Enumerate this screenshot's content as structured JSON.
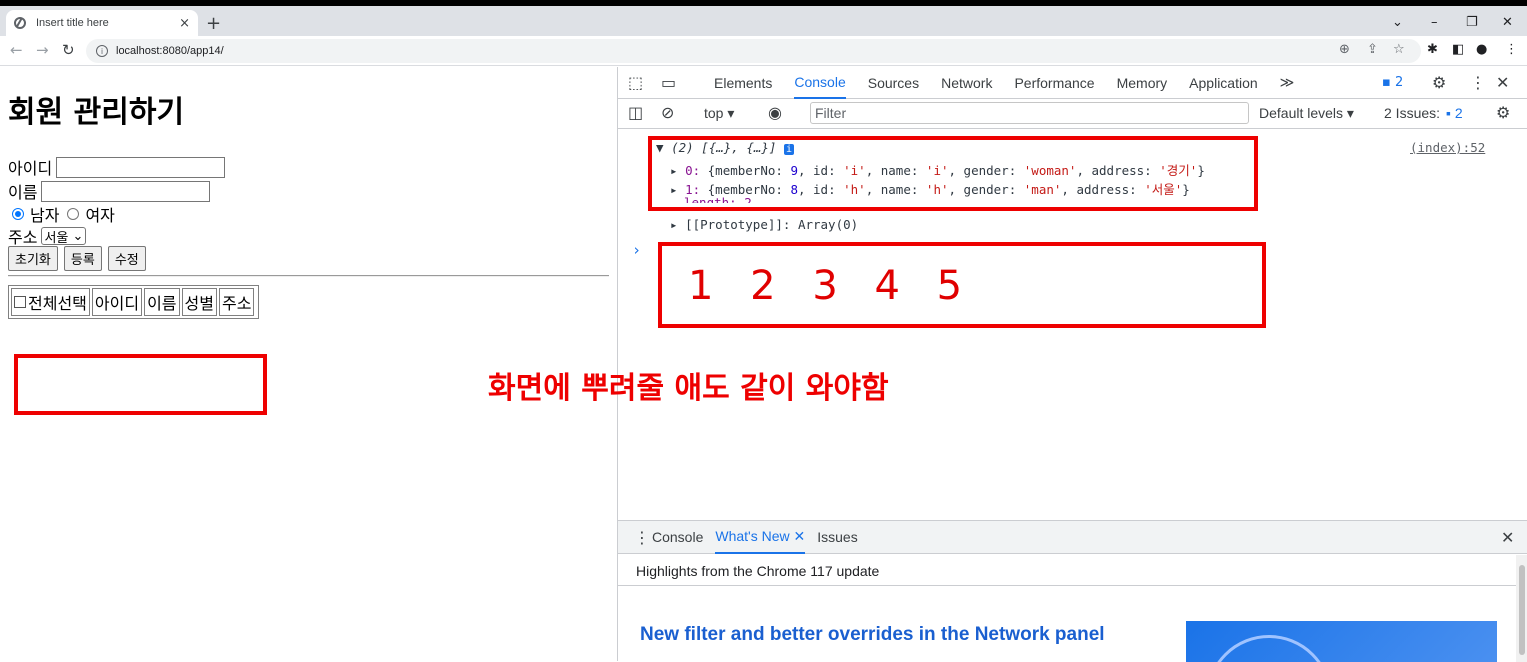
{
  "browser": {
    "tab_title": "Insert title here",
    "tab_close": "×",
    "new_tab": "+",
    "url": "localhost:8080/app14/",
    "win_min": "–",
    "win_restore": "❐",
    "win_close": "✕",
    "win_dropdown": "⌄"
  },
  "page": {
    "heading": "회원 관리하기",
    "id_label": "아이디",
    "name_label": "이름",
    "gender_male": "남자",
    "gender_female": "여자",
    "address_label": "주소",
    "address_selected": "서울",
    "buttons": {
      "reset": "초기화",
      "register": "등록",
      "edit": "수정"
    },
    "table_headers": [
      "전체선택",
      "아이디",
      "이름",
      "성별",
      "주소"
    ]
  },
  "devtools": {
    "tabs": [
      "Elements",
      "Console",
      "Sources",
      "Network",
      "Performance",
      "Memory",
      "Application"
    ],
    "active_tab": "Console",
    "more_tabs": "≫",
    "issues_badge": "2",
    "context": "top",
    "filter_placeholder": "Filter",
    "levels": "Default levels ▾",
    "issues_label": "2 Issues:",
    "issues_count": "2",
    "console": {
      "array_header": "(2) [{…}, {…}]",
      "source_link": "(index):52",
      "row0": {
        "index": "0:",
        "memberNo": "9",
        "id": "'i'",
        "name": "'i'",
        "gender": "'woman'",
        "address": "'경기'"
      },
      "row1": {
        "index": "1:",
        "memberNo": "8",
        "id": "'h'",
        "name": "'h'",
        "gender": "'man'",
        "address": "'서울'"
      },
      "length_text": "length: 2",
      "prototype_text": "[[Prototype]]: Array(0)",
      "prompt": "›"
    },
    "drawer": {
      "tabs": [
        "Console",
        "What's New",
        "Issues"
      ],
      "active": "What's New",
      "highlights": "Highlights from the Chrome 117 update",
      "whats_new_title": "New filter and better overrides in the Network panel"
    }
  },
  "annotations": {
    "numbers": "1 2 3 4 5",
    "note": "화면에 뿌려줄 애도 같이 와야함",
    "color": "#ee0000"
  }
}
